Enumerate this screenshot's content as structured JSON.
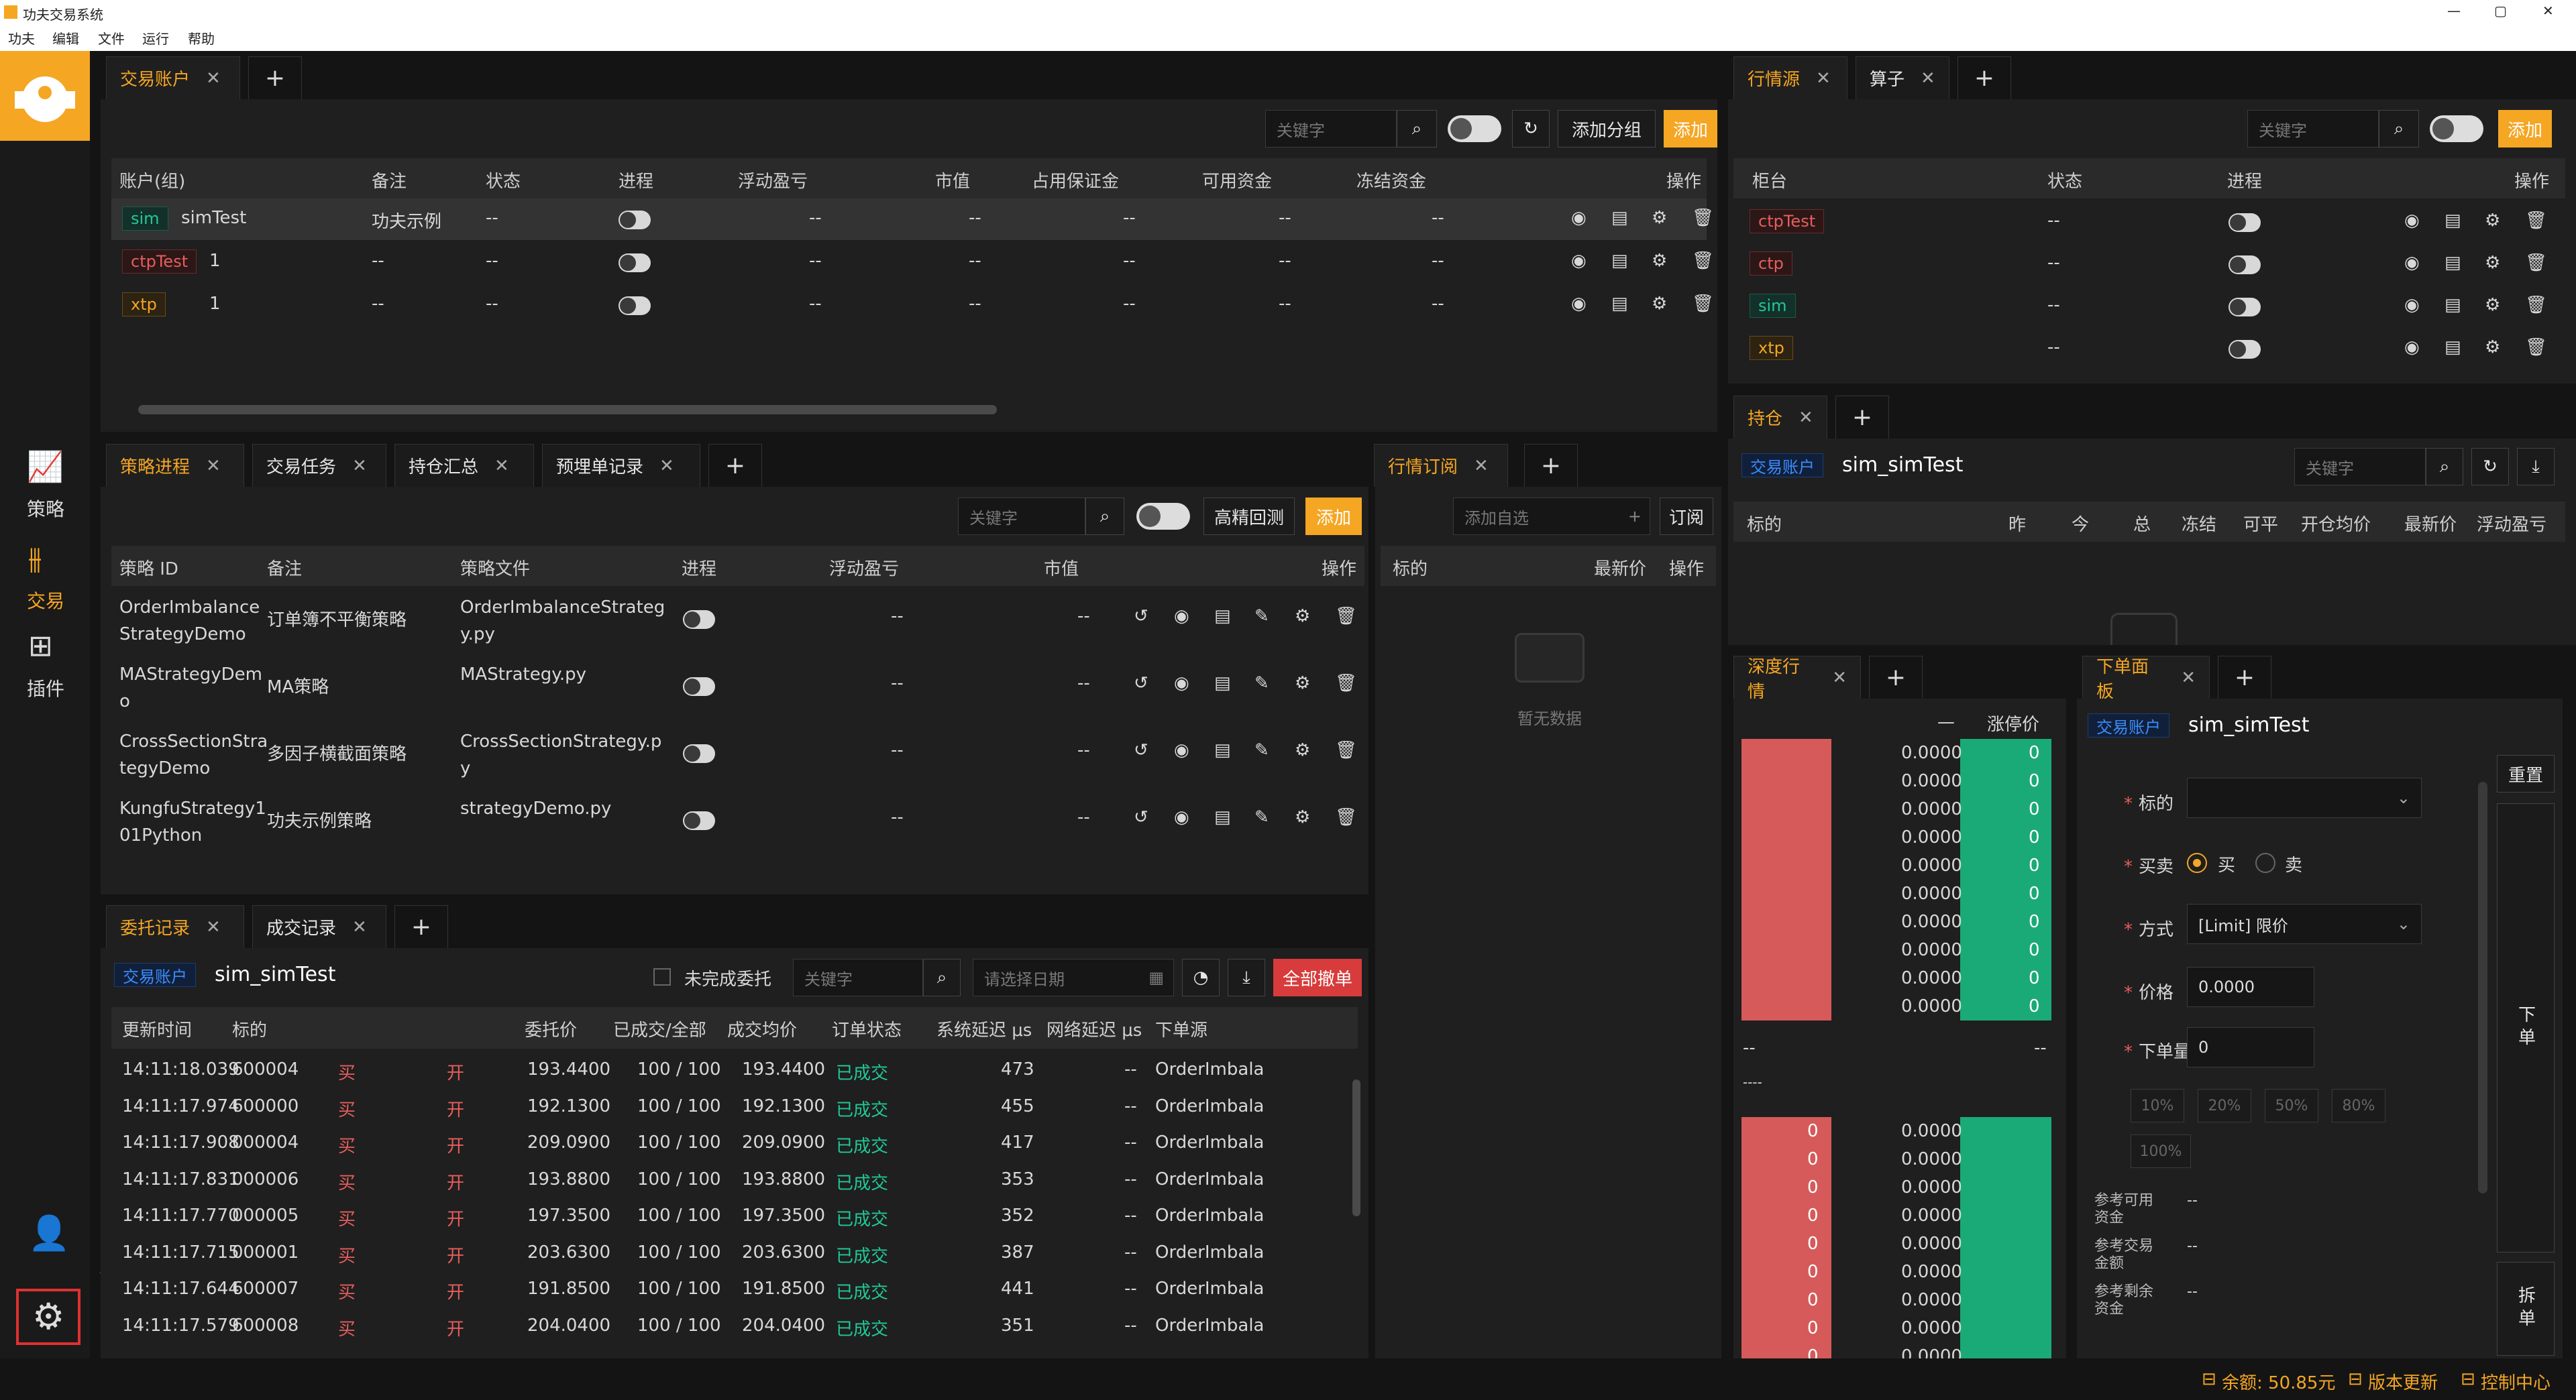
{
  "window": {
    "title": "功夫交易系统",
    "controls": [
      "—",
      "▢",
      "✕"
    ]
  },
  "menu": [
    "功夫",
    "编辑",
    "文件",
    "运行",
    "帮助"
  ],
  "sidebar": {
    "items": [
      {
        "label": "策略",
        "icon": "chart-icon"
      },
      {
        "label": "交易",
        "icon": "trade-icon"
      },
      {
        "label": "插件",
        "icon": "plugin-icon"
      }
    ]
  },
  "accounts": {
    "tab": "交易账户",
    "search_placeholder": "关键字",
    "add_group": "添加分组",
    "add": "添加",
    "headers": [
      "账户(组)",
      "备注",
      "状态",
      "进程",
      "浮动盈亏",
      "市值",
      "占用保证金",
      "可用资金",
      "冻结资金",
      "操作"
    ],
    "rows": [
      {
        "tag": "sim",
        "name": "simTest",
        "note": "功夫示例",
        "status": "--",
        "pnl": "--",
        "mv": "--",
        "margin": "--",
        "avail": "--",
        "frozen": "--"
      },
      {
        "tag": "ctpTest",
        "name": "1",
        "note": "--",
        "status": "--",
        "pnl": "--",
        "mv": "--",
        "margin": "--",
        "avail": "--",
        "frozen": "--"
      },
      {
        "tag": "xtp",
        "name": "1",
        "note": "--",
        "status": "--",
        "pnl": "--",
        "mv": "--",
        "margin": "--",
        "avail": "--",
        "frozen": "--"
      }
    ]
  },
  "md": {
    "tabs": [
      "行情源",
      "算子"
    ],
    "search_placeholder": "关键字",
    "add": "添加",
    "headers": [
      "柜台",
      "状态",
      "进程",
      "操作"
    ],
    "rows": [
      {
        "tag": "ctpTest",
        "status": "--"
      },
      {
        "tag": "ctp",
        "status": "--"
      },
      {
        "tag": "sim",
        "status": "--"
      },
      {
        "tag": "xtp",
        "status": "--"
      }
    ]
  },
  "positions": {
    "tab": "持仓",
    "account_tag": "交易账户",
    "account": "sim_simTest",
    "search_placeholder": "关键字",
    "headers": [
      "标的",
      "昨",
      "今",
      "总",
      "冻结",
      "可平",
      "开仓均价",
      "最新价",
      "浮动盈亏"
    ]
  },
  "strategy": {
    "tabs": [
      "策略进程",
      "交易任务",
      "持仓汇总",
      "预埋单记录"
    ],
    "search_placeholder": "关键字",
    "backtest": "高精回测",
    "add": "添加",
    "headers": [
      "策略 ID",
      "备注",
      "策略文件",
      "进程",
      "浮动盈亏",
      "市值",
      "操作"
    ],
    "rows": [
      {
        "id": [
          "OrderImbalance",
          "StrategyDemo"
        ],
        "note": "订单簿不平衡策略",
        "file": [
          "OrderImbalanceStrateg",
          "y.py"
        ],
        "pnl": "--",
        "mv": "--"
      },
      {
        "id": [
          "MAStrategyDem",
          "o"
        ],
        "note": "MA策略",
        "file": [
          "MAStrategy.py"
        ],
        "pnl": "--",
        "mv": "--"
      },
      {
        "id": [
          "CrossSectionStra",
          "tegyDemo"
        ],
        "note": "多因子横截面策略",
        "file": [
          "CrossSectionStrategy.p",
          "y"
        ],
        "pnl": "--",
        "mv": "--"
      },
      {
        "id": [
          "KungfuStrategy1",
          "01Python"
        ],
        "note": "功夫示例策略",
        "file": [
          "strategyDemo.py"
        ],
        "pnl": "--",
        "mv": "--"
      }
    ]
  },
  "subscribe": {
    "tab": "行情订阅",
    "add_placeholder": "添加自选",
    "subscribe": "订阅",
    "headers": [
      "标的",
      "最新价",
      "操作"
    ],
    "empty": "暂无数据"
  },
  "orders": {
    "tabs": [
      "委托记录",
      "成交记录"
    ],
    "account_tag": "交易账户",
    "account": "sim_simTest",
    "unfinished": "未完成委托",
    "search_placeholder": "关键字",
    "date_placeholder": "请选择日期",
    "cancel_all": "全部撤单",
    "headers": [
      "更新时间",
      "标的",
      "",
      "",
      "委托价",
      "已成交/全部",
      "成交均价",
      "订单状态",
      "系统延迟 μs",
      "网络延迟 μs",
      "下单源"
    ],
    "rows": [
      {
        "time": "14:11:18.039",
        "sym": "600004",
        "side": "买",
        "off": "开",
        "price": "193.4400",
        "fill": "100 / 100",
        "avg": "193.4400",
        "status": "已成交",
        "sys": "473",
        "net": "--",
        "src": "OrderImbala"
      },
      {
        "time": "14:11:17.974",
        "sym": "600000",
        "side": "买",
        "off": "开",
        "price": "192.1300",
        "fill": "100 / 100",
        "avg": "192.1300",
        "status": "已成交",
        "sys": "455",
        "net": "--",
        "src": "OrderImbala"
      },
      {
        "time": "14:11:17.908",
        "sym": "000004",
        "side": "买",
        "off": "开",
        "price": "209.0900",
        "fill": "100 / 100",
        "avg": "209.0900",
        "status": "已成交",
        "sys": "417",
        "net": "--",
        "src": "OrderImbala"
      },
      {
        "time": "14:11:17.831",
        "sym": "000006",
        "side": "买",
        "off": "开",
        "price": "193.8800",
        "fill": "100 / 100",
        "avg": "193.8800",
        "status": "已成交",
        "sys": "353",
        "net": "--",
        "src": "OrderImbala"
      },
      {
        "time": "14:11:17.770",
        "sym": "000005",
        "side": "买",
        "off": "开",
        "price": "197.3500",
        "fill": "100 / 100",
        "avg": "197.3500",
        "status": "已成交",
        "sys": "352",
        "net": "--",
        "src": "OrderImbala"
      },
      {
        "time": "14:11:17.715",
        "sym": "000001",
        "side": "买",
        "off": "开",
        "price": "203.6300",
        "fill": "100 / 100",
        "avg": "203.6300",
        "status": "已成交",
        "sys": "387",
        "net": "--",
        "src": "OrderImbala"
      },
      {
        "time": "14:11:17.644",
        "sym": "600007",
        "side": "买",
        "off": "开",
        "price": "191.8500",
        "fill": "100 / 100",
        "avg": "191.8500",
        "status": "已成交",
        "sys": "441",
        "net": "--",
        "src": "OrderImbala"
      },
      {
        "time": "14:11:17.579",
        "sym": "600008",
        "side": "买",
        "off": "开",
        "price": "204.0400",
        "fill": "100 / 100",
        "avg": "204.0400",
        "status": "已成交",
        "sys": "351",
        "net": "--",
        "src": "OrderImbala"
      }
    ]
  },
  "depth": {
    "tab": "深度行情",
    "header_dash": "—",
    "limit_label": "涨停价",
    "ask_prices": [
      "0.0000",
      "0.0000",
      "0.0000",
      "0.0000",
      "0.0000",
      "0.0000",
      "0.0000",
      "0.0000",
      "0.0000",
      "0.0000"
    ],
    "ask_vols": [
      "0",
      "0",
      "0",
      "0",
      "0",
      "0",
      "0",
      "0",
      "0",
      "0"
    ],
    "mid_left": "--",
    "mid_right": "--",
    "mid_sub": "----",
    "bid_prices": [
      "0.0000",
      "0.0000",
      "0.0000",
      "0.0000",
      "0.0000",
      "0.0000",
      "0.0000",
      "0.0000",
      "0.0000"
    ],
    "bid_vols": [
      "0",
      "0",
      "0",
      "0",
      "0",
      "0",
      "0",
      "0",
      "0"
    ]
  },
  "order_panel": {
    "tab": "下单面板",
    "account_tag": "交易账户",
    "account": "sim_simTest",
    "reset": "重置",
    "symbol_label": "标的",
    "side_label": "买卖",
    "buy": "买",
    "sell": "卖",
    "type_label": "方式",
    "type_value": "[Limit] 限价",
    "price_label": "价格",
    "price_value": "0.0000",
    "qty_label": "下单量",
    "qty_value": "0",
    "pcts": [
      "10%",
      "20%",
      "50%",
      "80%",
      "100%"
    ],
    "ref1": "参考可用资金",
    "ref2": "参考交易金额",
    "ref3": "参考剩余资金",
    "ref_val": "--",
    "place": "下单",
    "split": "拆单"
  },
  "status": {
    "balance": "余额: 50.85元",
    "update": "版本更新",
    "control": "控制中心"
  },
  "colors": {
    "accent": "#f5a623",
    "buy": "#e85d5d",
    "sell": "#20c997"
  }
}
